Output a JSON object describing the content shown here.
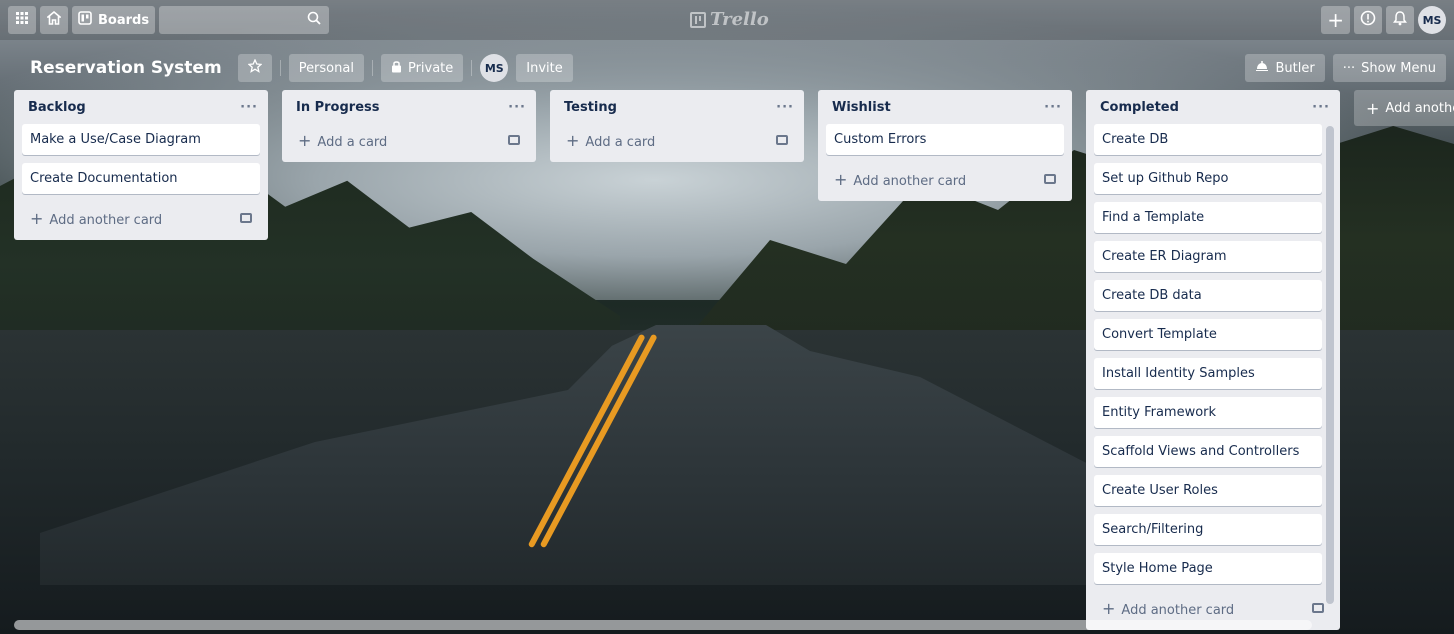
{
  "topnav": {
    "boards_label": "Boards",
    "logo_text": "Trello",
    "avatar_initials": "MS"
  },
  "board": {
    "title": "Reservation System",
    "team_label": "Personal",
    "visibility_label": "Private",
    "member_initials": "MS",
    "invite_label": "Invite",
    "butler_label": "Butler",
    "show_menu_label": "Show Menu"
  },
  "lists": [
    {
      "title": "Backlog",
      "cards": [
        "Make a Use/Case Diagram",
        "Create Documentation"
      ],
      "add_label": "Add another card"
    },
    {
      "title": "In Progress",
      "cards": [],
      "add_label": "Add a card"
    },
    {
      "title": "Testing",
      "cards": [],
      "add_label": "Add a card"
    },
    {
      "title": "Wishlist",
      "cards": [
        "Custom Errors"
      ],
      "add_label": "Add another card"
    },
    {
      "title": "Completed",
      "cards": [
        "Create DB",
        "Set up Github Repo",
        "Find a Template",
        "Create ER Diagram",
        "Create DB data",
        "Convert Template",
        "Install Identity Samples",
        "Entity Framework",
        "Scaffold Views and Controllers",
        "Create User Roles",
        "Search/Filtering",
        "Style Home Page"
      ],
      "add_label": "Add another card"
    }
  ],
  "add_list_label": "Add another list",
  "colors": {
    "list_bg": "#ebecf0",
    "card_bg": "#ffffff",
    "text": "#172b4d"
  }
}
